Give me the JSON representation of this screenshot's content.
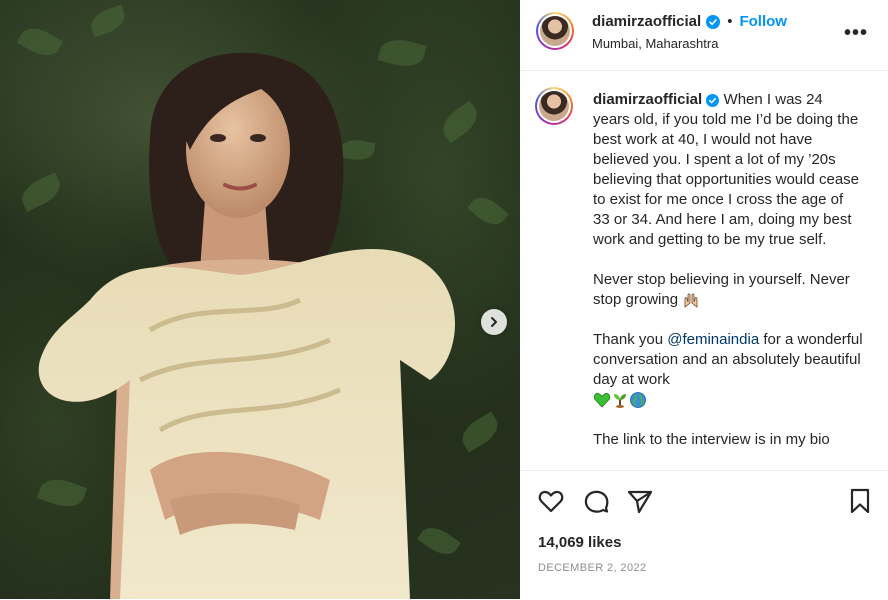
{
  "post": {
    "username": "diamirzaofficial",
    "follow_label": "Follow",
    "separator": "•",
    "location": "Mumbai, Maharashtra",
    "more_label": "•••"
  },
  "caption": {
    "username": "diamirzaofficial",
    "paragraph1": "When I was 24 years old, if you told me I’d be doing the best work at 40, I would not have believed you. I spent a lot of my ’20s believing that opportunities would cease to exist for me once I cross the age of 33 or 34. And here I am, doing my best work and getting to be my true self.",
    "paragraph2": "Never stop believing in yourself. Never stop growing",
    "paragraph3_before": "Thank you ",
    "paragraph3_mention": "@feminaindia",
    "paragraph3_after": " for a wonderful conversation and an absolutely beautiful day at work",
    "paragraph4": "The link to the interview is in my bio",
    "emoji_icons": [
      "raising-hands-icon",
      "green-heart-icon",
      "seedling-icon",
      "globe-icon"
    ]
  },
  "engagement": {
    "likes": "14,069 likes",
    "date": "DECEMBER 2, 2022"
  },
  "icons": {
    "like": "heart-icon",
    "comment": "comment-icon",
    "share": "paper-plane-icon",
    "save": "bookmark-icon",
    "next": "chevron-right-icon",
    "verified": "verified-badge-icon"
  },
  "colors": {
    "follow": "#0095f6",
    "verified": "#0095f6",
    "mention": "#00376b",
    "meta": "#8e8e8e"
  }
}
